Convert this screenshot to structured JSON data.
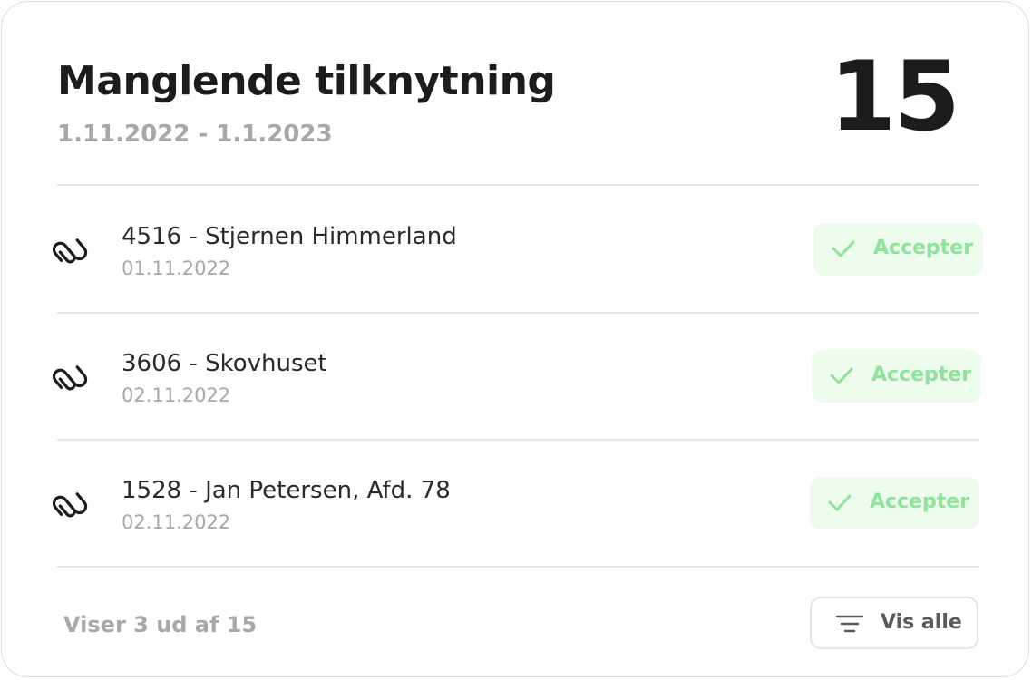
{
  "header": {
    "title": "Manglende tilknytning",
    "date_range": "1.11.2022 - 1.1.2023",
    "count": "15"
  },
  "items": [
    {
      "title": "4516 - Stjernen Himmerland",
      "date": "01.11.2022",
      "action_label": "Accepter",
      "icon": "paperclip-icon"
    },
    {
      "title": "3606 - Skovhuset",
      "date": "02.11.2022",
      "action_label": "Accepter",
      "icon": "paperclip-icon"
    },
    {
      "title": "1528 - Jan Petersen, Afd. 78",
      "date": "02.11.2022",
      "action_label": "Accepter",
      "icon": "paperclip-icon"
    }
  ],
  "footer": {
    "status_text": "Viser 3 ud af 15",
    "show_all_label": "Vis alle",
    "show_all_icon": "filter-icon"
  },
  "colors": {
    "accent_green": "#8fe39b",
    "accent_green_bg": "#eefcee",
    "muted_text": "#a8a8a8",
    "primary_text": "#1c1c1c"
  }
}
